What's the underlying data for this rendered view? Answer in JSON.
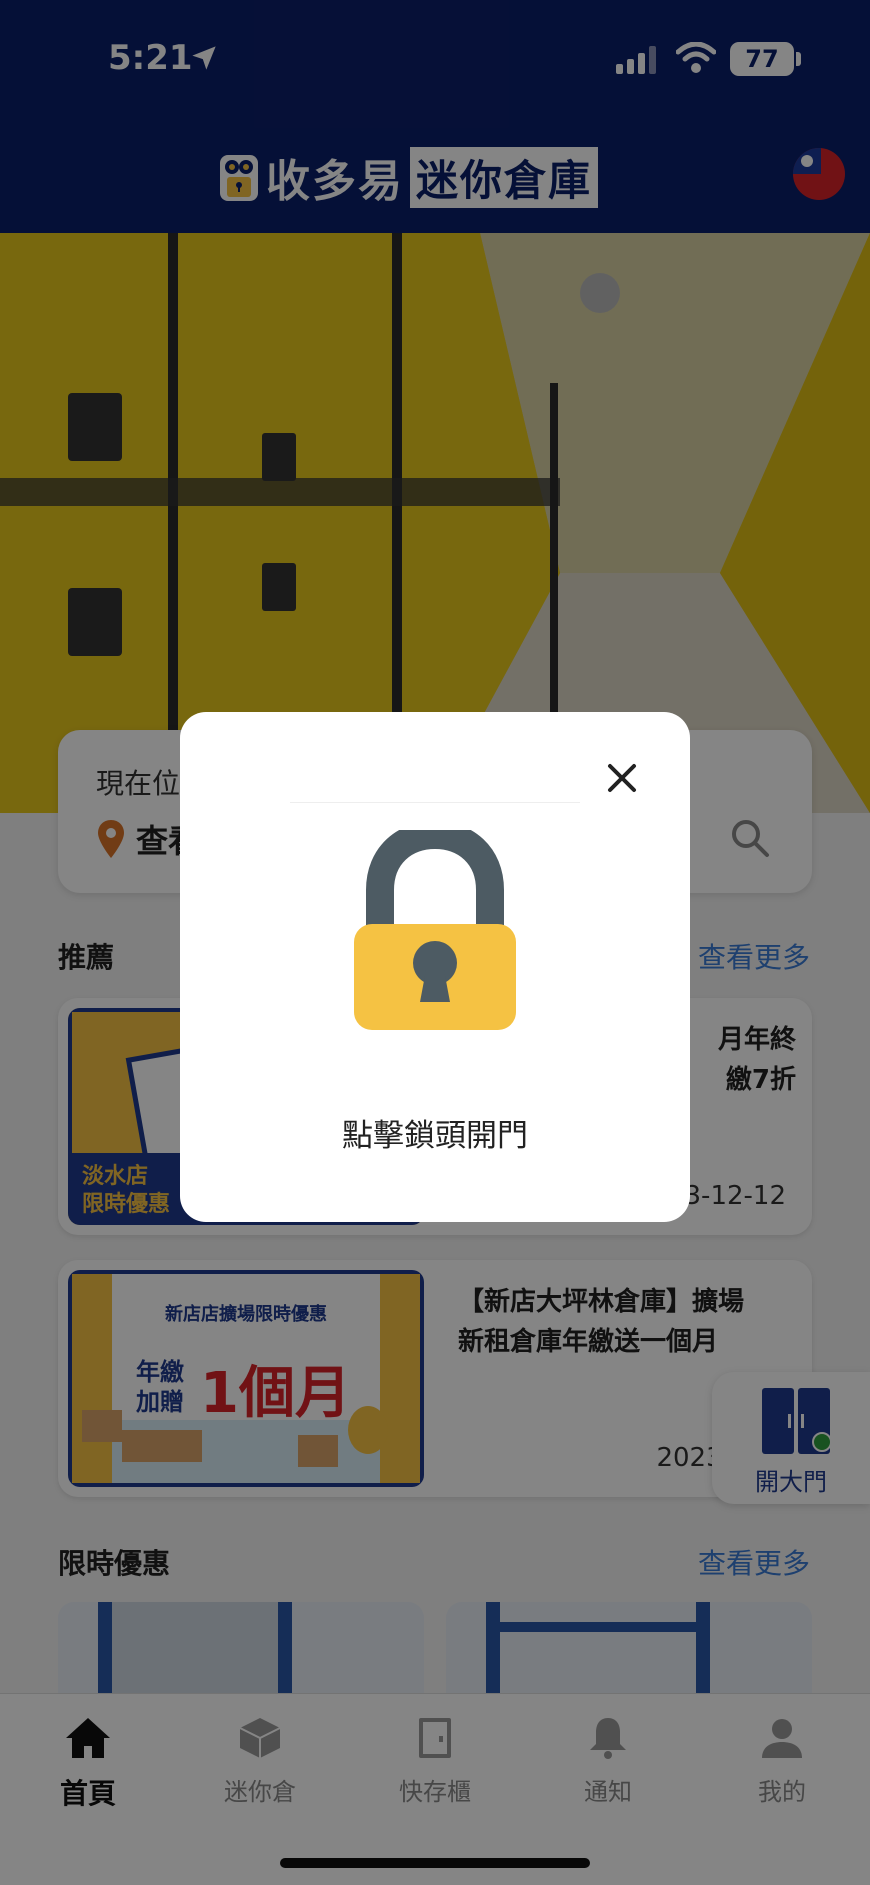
{
  "status_bar": {
    "time": "5:21",
    "battery": "77"
  },
  "header": {
    "brand_name": "收多易",
    "brand_sub": "迷你倉庫"
  },
  "search": {
    "label": "現在位",
    "value": "查看"
  },
  "recommend": {
    "title": "推薦",
    "more": "查看更多",
    "cards": [
      {
        "badge_line1": "淡水店",
        "badge_line2": "限時優惠",
        "title_line1": "月年終",
        "title_line2": "繳7折",
        "date": "3-12-12"
      },
      {
        "banner_top": "新店店擴場限時優惠",
        "banner_left1": "年繳",
        "banner_left2": "加贈",
        "banner_big": "1個月",
        "title_line1": "【新店大坪林倉庫】擴場",
        "title_line2": "新租倉庫年繳送一個月",
        "date": "2023-"
      }
    ]
  },
  "deals": {
    "title": "限時優惠",
    "more": "查看更多"
  },
  "gate_button": {
    "label": "開大門"
  },
  "tabs": [
    {
      "label": "首頁",
      "icon": "home-icon"
    },
    {
      "label": "迷你倉",
      "icon": "box-icon"
    },
    {
      "label": "快存櫃",
      "icon": "locker-door-icon"
    },
    {
      "label": "通知",
      "icon": "bell-icon"
    },
    {
      "label": "我的",
      "icon": "person-icon"
    }
  ],
  "modal": {
    "message": "點擊鎖頭開門"
  },
  "colors": {
    "navy": "#0b1f6a",
    "accent_blue": "#3a7bd5",
    "lock_yellow": "#f5c243",
    "lock_shackle": "#4d5b63"
  }
}
